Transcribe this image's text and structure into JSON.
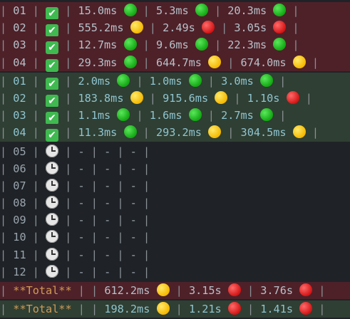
{
  "rows": [
    {
      "id": "01",
      "status": "check",
      "cells": [
        {
          "v": "15.0ms",
          "s": "green"
        },
        {
          "v": "5.3ms",
          "s": "green"
        },
        {
          "v": "20.3ms",
          "s": "green"
        }
      ],
      "band": "red"
    },
    {
      "id": "02",
      "status": "check",
      "cells": [
        {
          "v": "555.2ms",
          "s": "yellow"
        },
        {
          "v": "2.49s",
          "s": "red"
        },
        {
          "v": "3.05s",
          "s": "red"
        }
      ],
      "band": "red"
    },
    {
      "id": "03",
      "status": "check",
      "cells": [
        {
          "v": "12.7ms",
          "s": "green"
        },
        {
          "v": "9.6ms",
          "s": "green"
        },
        {
          "v": "22.3ms",
          "s": "green"
        }
      ],
      "band": "red"
    },
    {
      "id": "04",
      "status": "check",
      "cells": [
        {
          "v": "29.3ms",
          "s": "green"
        },
        {
          "v": "644.7ms",
          "s": "yellow"
        },
        {
          "v": "674.0ms",
          "s": "yellow"
        }
      ],
      "band": "red"
    },
    {
      "id": "01",
      "status": "check",
      "cells": [
        {
          "v": "2.0ms",
          "s": "green"
        },
        {
          "v": "1.0ms",
          "s": "green"
        },
        {
          "v": "3.0ms",
          "s": "green"
        }
      ],
      "band": "green"
    },
    {
      "id": "02",
      "status": "check",
      "cells": [
        {
          "v": "183.8ms",
          "s": "yellow"
        },
        {
          "v": "915.6ms",
          "s": "yellow"
        },
        {
          "v": "1.10s",
          "s": "red"
        }
      ],
      "band": "green"
    },
    {
      "id": "03",
      "status": "check",
      "cells": [
        {
          "v": "1.1ms",
          "s": "green"
        },
        {
          "v": "1.6ms",
          "s": "green"
        },
        {
          "v": "2.7ms",
          "s": "green"
        }
      ],
      "band": "green"
    },
    {
      "id": "04",
      "status": "check",
      "cells": [
        {
          "v": "11.3ms",
          "s": "green"
        },
        {
          "v": "293.2ms",
          "s": "yellow"
        },
        {
          "v": "304.5ms",
          "s": "yellow"
        }
      ],
      "band": "green"
    },
    {
      "id": "05",
      "status": "clock",
      "cells": [
        {
          "v": "-"
        },
        {
          "v": "-"
        },
        {
          "v": "-"
        }
      ],
      "band": "none"
    },
    {
      "id": "06",
      "status": "clock",
      "cells": [
        {
          "v": "-"
        },
        {
          "v": "-"
        },
        {
          "v": "-"
        }
      ],
      "band": "none"
    },
    {
      "id": "07",
      "status": "clock",
      "cells": [
        {
          "v": "-"
        },
        {
          "v": "-"
        },
        {
          "v": "-"
        }
      ],
      "band": "none"
    },
    {
      "id": "08",
      "status": "clock",
      "cells": [
        {
          "v": "-"
        },
        {
          "v": "-"
        },
        {
          "v": "-"
        }
      ],
      "band": "none"
    },
    {
      "id": "09",
      "status": "clock",
      "cells": [
        {
          "v": "-"
        },
        {
          "v": "-"
        },
        {
          "v": "-"
        }
      ],
      "band": "none"
    },
    {
      "id": "10",
      "status": "clock",
      "cells": [
        {
          "v": "-"
        },
        {
          "v": "-"
        },
        {
          "v": "-"
        }
      ],
      "band": "none"
    },
    {
      "id": "11",
      "status": "clock",
      "cells": [
        {
          "v": "-"
        },
        {
          "v": "-"
        },
        {
          "v": "-"
        }
      ],
      "band": "none"
    },
    {
      "id": "12",
      "status": "clock",
      "cells": [
        {
          "v": "-"
        },
        {
          "v": "-"
        },
        {
          "v": "-"
        }
      ],
      "band": "none"
    }
  ],
  "totals": [
    {
      "label": "**Total**",
      "cells": [
        {
          "v": "612.2ms",
          "s": "yellow"
        },
        {
          "v": "3.15s",
          "s": "red"
        },
        {
          "v": "3.76s",
          "s": "red"
        }
      ],
      "band": "total-red"
    },
    {
      "label": "**Total**",
      "cells": [
        {
          "v": "198.2ms",
          "s": "yellow"
        },
        {
          "v": "1.21s",
          "s": "red"
        },
        {
          "v": "1.41s",
          "s": "red"
        }
      ],
      "band": "total-green"
    }
  ],
  "colors": {
    "background": "#1f2327",
    "band_red": "#4e2129",
    "band_green": "#2f3f33",
    "status_green": "#13a813",
    "status_yellow": "#f5b800",
    "status_red": "#d41414",
    "check_green": "#3fb950",
    "total_label": "#d19a55"
  },
  "icons": {
    "check": "check-mark-button-icon",
    "clock": "clock-icon",
    "green": "green-circle-icon",
    "yellow": "yellow-circle-icon",
    "red": "red-circle-icon"
  },
  "sep": "|"
}
